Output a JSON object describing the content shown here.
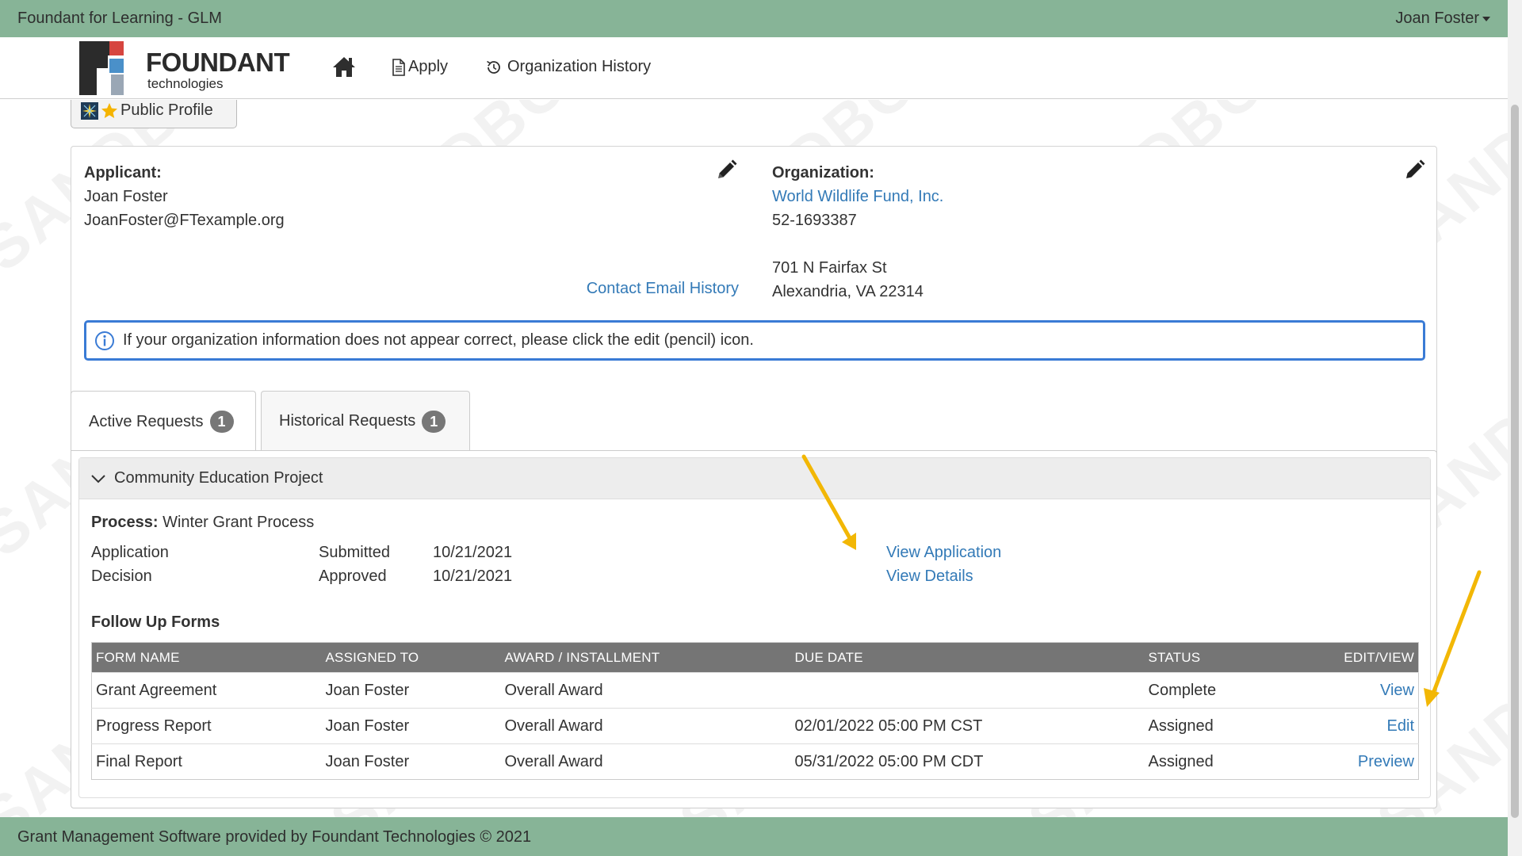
{
  "topbar": {
    "app_title": "Foundant for Learning - GLM",
    "user_name": "Joan Foster"
  },
  "nav": {
    "logo_word": "FOUNDANT",
    "logo_sub": "technologies",
    "home_icon": "home-icon",
    "apply_label": "Apply",
    "history_label": "Organization History"
  },
  "public_profile": {
    "label": "Public Profile"
  },
  "applicant": {
    "heading": "Applicant:",
    "name": "Joan Foster",
    "email": "JoanFoster@FTexample.org",
    "contact_email_history": "Contact Email History"
  },
  "organization": {
    "heading": "Organization:",
    "name": "World Wildlife Fund, Inc.",
    "ein": "52-1693387",
    "address_line1": "701 N Fairfax St",
    "address_line2": "Alexandria, VA 22314"
  },
  "alert": {
    "message": "If your organization information does not appear correct, please click the edit (pencil) icon."
  },
  "tabs": [
    {
      "label": "Active Requests",
      "count": "1"
    },
    {
      "label": "Historical Requests",
      "count": "1"
    }
  ],
  "request": {
    "title": "Community Education Project",
    "process_label": "Process:",
    "process_value": "Winter Grant Process",
    "rows": [
      {
        "stage": "Application",
        "status": "Submitted",
        "date": "10/21/2021"
      },
      {
        "stage": "Decision",
        "status": "Approved",
        "date": "10/21/2021"
      }
    ],
    "view_application": "View Application",
    "view_details": "View Details",
    "follow_up_title": "Follow Up Forms"
  },
  "forms_table": {
    "headers": [
      "FORM NAME",
      "ASSIGNED TO",
      "AWARD / INSTALLMENT",
      "DUE DATE",
      "STATUS",
      "EDIT/VIEW"
    ],
    "rows": [
      {
        "form": "Grant Agreement",
        "assigned": "Joan Foster",
        "award": "Overall Award",
        "due": "",
        "status": "Complete",
        "action": "View"
      },
      {
        "form": "Progress Report",
        "assigned": "Joan Foster",
        "award": "Overall Award",
        "due": "02/01/2022 05:00 PM CST",
        "status": "Assigned",
        "action": "Edit"
      },
      {
        "form": "Final Report",
        "assigned": "Joan Foster",
        "award": "Overall Award",
        "due": "05/31/2022 05:00 PM CDT",
        "status": "Assigned",
        "action": "Preview"
      }
    ]
  },
  "footer": {
    "text": "Grant Management Software provided by Foundant Technologies © 2021"
  },
  "watermark": {
    "text": "SANDBOX"
  },
  "colors": {
    "header_green": "#87b497",
    "link_blue": "#337ab7",
    "alert_border": "#3a7bd5",
    "table_header": "#757575",
    "annotation_arrow": "#f2b705"
  }
}
